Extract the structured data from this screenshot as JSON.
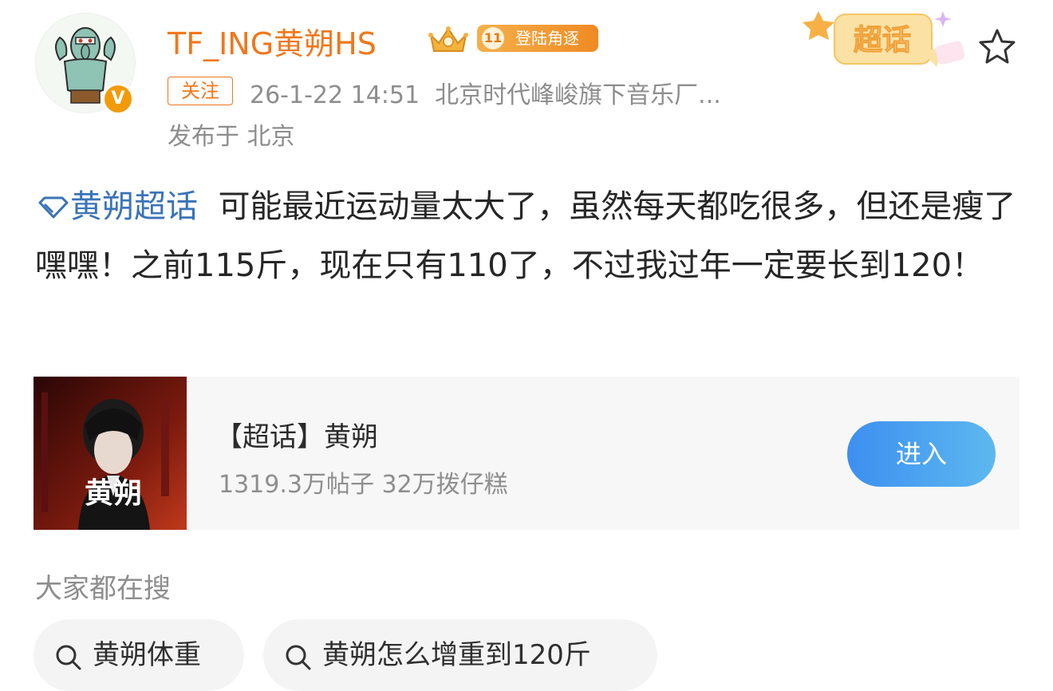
{
  "post": {
    "author": {
      "name": "TF_ING黄朔HS",
      "level": "11",
      "badge_label": "登陆角逐",
      "verified_mark": "V"
    },
    "follow_label": "关注",
    "timestamp": "26-1-22 14:51",
    "source": "北京时代峰峻旗下音乐厂...",
    "location": "发布于 北京",
    "super_badge_label": "超话",
    "topic": "黄朔超话",
    "text": "可能最近运动量太大了，虽然每天都吃很多，但还是瘦了嘿嘿！之前115斤，现在只有110了，不过我过年一定要长到120！"
  },
  "supertopic_card": {
    "title": "【超话】黄朔",
    "stats": "1319.3万帖子 32万拨仔糕",
    "image_text": "黄朔",
    "enter_label": "进入"
  },
  "search": {
    "heading": "大家都在搜",
    "suggestions": [
      "黄朔体重",
      "黄朔怎么增重到120斤"
    ]
  },
  "colors": {
    "username": "#f0771c",
    "topic_link": "#3a73b7",
    "enter_button": "#4aa3f0",
    "meta_text": "#8d8d8d"
  },
  "icons": [
    "avatar-image",
    "verified-v-icon",
    "crown-icon",
    "level-badge-icon",
    "super-topic-badge-icon",
    "star-icon",
    "supertopic-diamond-icon",
    "search-icon"
  ]
}
